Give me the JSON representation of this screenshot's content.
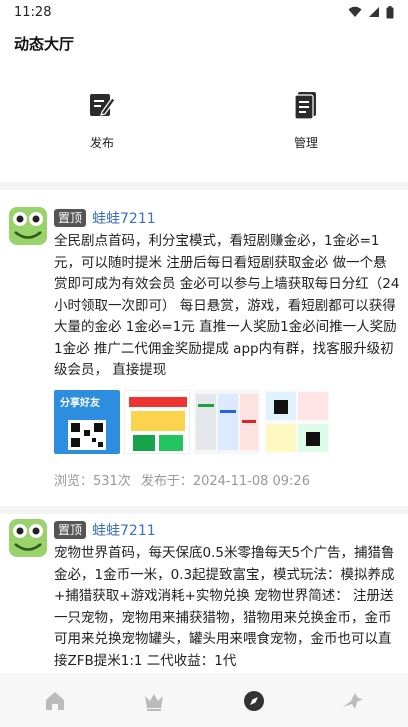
{
  "status": {
    "time": "11:28"
  },
  "app": {
    "title": "动态大厅"
  },
  "actions": {
    "publish_label": "发布",
    "manage_label": "管理"
  },
  "posts": [
    {
      "badge": "置顶",
      "user": "蛙蛙7211",
      "text": "全民剧点首码，利分宝模式，看短剧赚金必，1金必=1元，可以随时提米 注册后每日看短剧获取金必 做一个悬赏即可成为有效会员 金必可以参与上墙获取每日分红（24小时领取一次即可） 每日悬赏，游戏，看短剧都可以获得大量的金必 1金必=1元 直推一人奖励1金必间推一人奖励1金必 推广二代佣金奖励提成 app内有群，找客服升级初级会员， 直接提现",
      "thumb_label": "分享好友",
      "views": "浏览：531次",
      "published": "发布于：2024-11-08 09:26"
    },
    {
      "badge": "置顶",
      "user": "蛙蛙7211",
      "text": "宠物世界首码，每天保底0.5米零撸每天5个广告，捕猎鲁金必，1金币一米，0.3起提致富宝，模式玩法：模拟养成+捕猎获取+游戏消耗+实物兑换 宠物世界简述： 注册送一只宠物，宠物用来捕获猎物，猎物用来兑换金币，金币可用来兑换宠物罐头，罐头用来喂食宠物，金币也可以直接ZFB提米1:1 二代收益：1代"
    }
  ],
  "nav": [
    "home-icon",
    "crown-icon",
    "compass-icon",
    "bird-icon"
  ]
}
